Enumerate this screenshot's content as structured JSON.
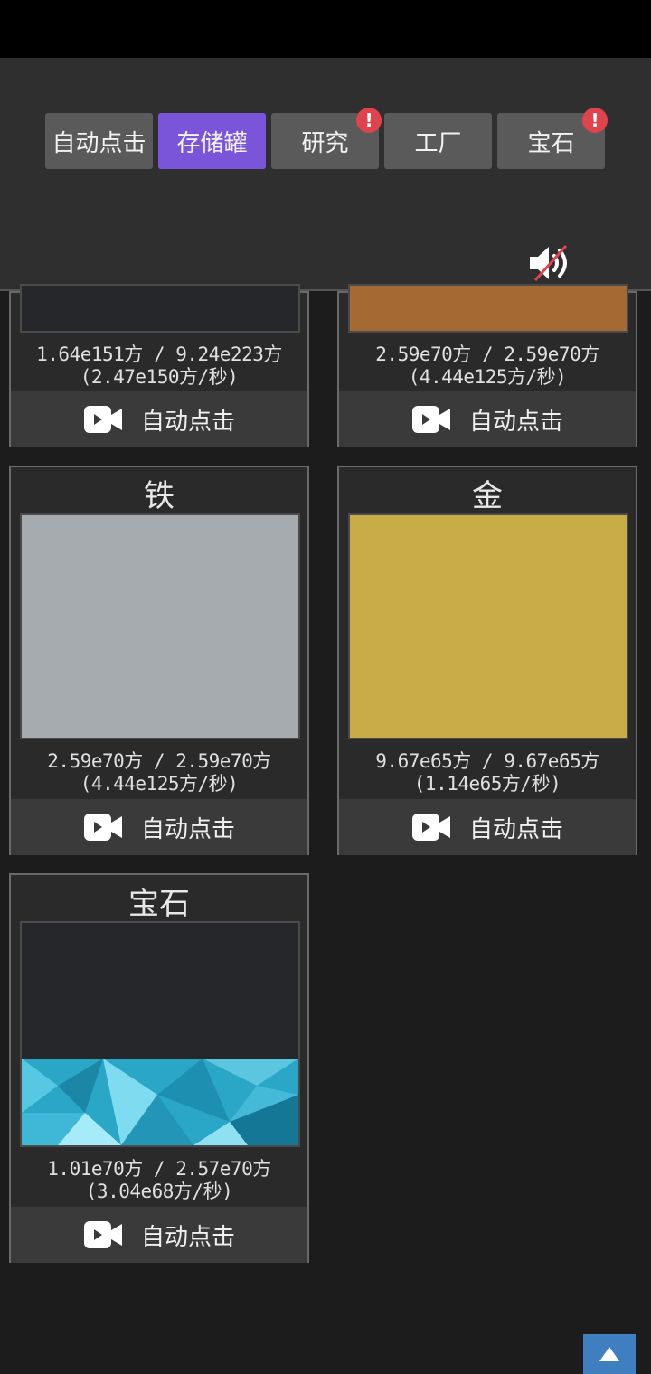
{
  "tabs": [
    {
      "label": "自动点击",
      "active": false,
      "badge": ""
    },
    {
      "label": "存储罐",
      "active": true,
      "badge": ""
    },
    {
      "label": "研究",
      "active": false,
      "badge": "!"
    },
    {
      "label": "工厂",
      "active": false,
      "badge": ""
    },
    {
      "label": "宝石",
      "active": false,
      "badge": "!"
    }
  ],
  "sound": {
    "icon": "speaker-muted-icon"
  },
  "cards": [
    {
      "title": "",
      "amount": "1.64e151方 / 9.24e223方",
      "rate": "(2.47e150方/秒)",
      "button": "自动点击",
      "fill_color": "#25272a",
      "fill_level": 0
    },
    {
      "title": "",
      "amount": "2.59e70方 / 2.59e70方",
      "rate": "(4.44e125方/秒)",
      "button": "自动点击",
      "fill_color": "#a56a34",
      "fill_level": 1
    },
    {
      "title": "铁",
      "amount": "2.59e70方 / 2.59e70方",
      "rate": "(4.44e125方/秒)",
      "button": "自动点击",
      "fill_color": "#a6abaf",
      "fill_level": 1
    },
    {
      "title": "金",
      "amount": "9.67e65方 / 9.67e65方",
      "rate": "(1.14e65方/秒)",
      "button": "自动点击",
      "fill_color": "#c9ab48",
      "fill_level": 1
    },
    {
      "title": "宝石",
      "amount": "1.01e70方 / 2.57e70方",
      "rate": "(3.04e68方/秒)",
      "button": "自动点击",
      "fill_color": "#2aa7c7",
      "fill_level": 0.39
    }
  ],
  "colors": {
    "accent": "#7b55d9",
    "badge": "#e0434b",
    "scroll_button": "#3f7fc0"
  }
}
